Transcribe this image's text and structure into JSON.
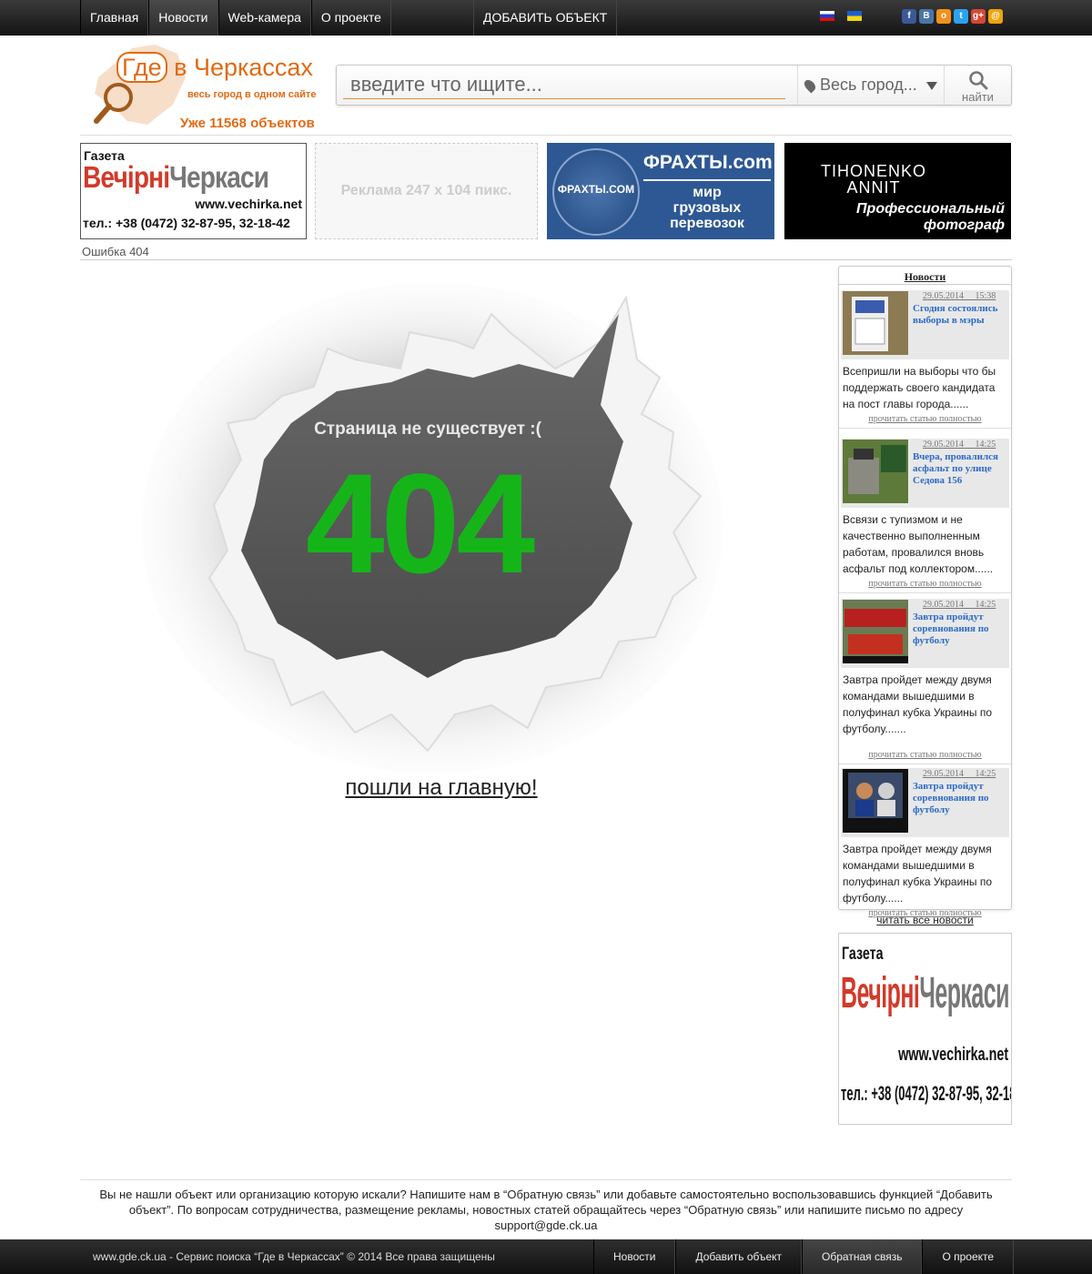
{
  "topnav": {
    "items": [
      {
        "label": "Главная"
      },
      {
        "label": "Новости",
        "active": true
      },
      {
        "label": "Web-камера"
      },
      {
        "label": "О проекте"
      }
    ],
    "add_object": "ДОБАВИТЬ ОБЪЕКТ",
    "languages": [
      "flag-ru-icon",
      "flag-ua-icon"
    ],
    "social": [
      "facebook-icon",
      "vkontakte-icon",
      "odnoklassniki-icon",
      "twitter-icon",
      "google-plus-icon",
      "mail-icon"
    ]
  },
  "logo": {
    "gde": "Где",
    "v": "в",
    "city": "Черкассах",
    "tagline": "весь город в одном сайте",
    "count_text": "Уже 11568 объектов"
  },
  "search": {
    "placeholder": "введите что ищите...",
    "city": "Весь город...",
    "button": "найти"
  },
  "banners": {
    "vechirka": {
      "gazeta": "Газета",
      "name_red": "Вечірні",
      "name_grey": "Черкаси",
      "url": "www.vechirka.net",
      "tel": "тел.: +38 (0472) 32-87-95, 32-18-42"
    },
    "ad_placeholder": "Реклама 247 x 104 пикс.",
    "frakhty": {
      "circle": "ФРАХТЫ.COM",
      "title": "ФРАХТЫ.com",
      "subtitle": "мир\nгрузовых\nперевозок"
    },
    "tihonenko": {
      "name": "TIHONENKO\nANNIT",
      "tagline": "Профессиональный\nфотограф"
    }
  },
  "breadcrumb": "Ошибка 404",
  "error": {
    "message": "Страница не существует :(",
    "code": "404",
    "home_link": "пошли на главную!"
  },
  "news": {
    "title": "Новости",
    "items": [
      {
        "date": "29.05.2014",
        "time": "15:38",
        "headline": "Сгодня состоялись выборы в мэры",
        "text": "Всепришли на выборы что бы поддержать своего кандидата на пост главы города......",
        "more": "прочитать статью полностью"
      },
      {
        "date": "29.05.2014",
        "time": "14:25",
        "headline": "Вчера, провалился асфальт по улице Седова 156",
        "text": "Всвязи с тупизмом и не качественно выполненным работам, провалился вновь асфальт под коллектором......",
        "more": "прочитать статью полностью"
      },
      {
        "date": "29.05.2014",
        "time": "14:25",
        "headline": "Завтра пройдут соревнования по футболу",
        "text": "Завтра пройдет между двумя командами вышедшими в полуфинал кубка Украины по футболу.......",
        "more": "прочитать статью полностью"
      },
      {
        "date": "29.05.2014",
        "time": "14:25",
        "headline": "Завтра пройдут соревнования по футболу",
        "text": "Завтра пройдет между двумя командами вышедшими в полуфинал кубка Украины по футболу......",
        "more": "прочитать статью полностью"
      }
    ],
    "all_link": "читать все новости"
  },
  "footer": {
    "text": "Вы не нашли объект или организацию которую искали? Напишите нам в “Обратную связь” или добавьте самостоятельно воспользовавшись функцией “Добавить объект”. По вопросам сотрудничества, размещение рекламы, новостных статей обращайтесь через “Обратную связь” или напишите письмо по адресу support@gde.ck.ua",
    "copyright": "www.gde.ck.ua - Сервис поиска  “Где в Черкассах” © 2014 Все права защищены",
    "nav": [
      {
        "label": "Новости"
      },
      {
        "label": "Добавить объект"
      },
      {
        "label": "Обратная связь",
        "active": true
      },
      {
        "label": "О проекте"
      }
    ]
  },
  "colors": {
    "accent_orange": "#e06a14",
    "error_green": "#15b51a",
    "link_blue": "#2a6ac8",
    "dark_bar": "#1c1c1c"
  }
}
